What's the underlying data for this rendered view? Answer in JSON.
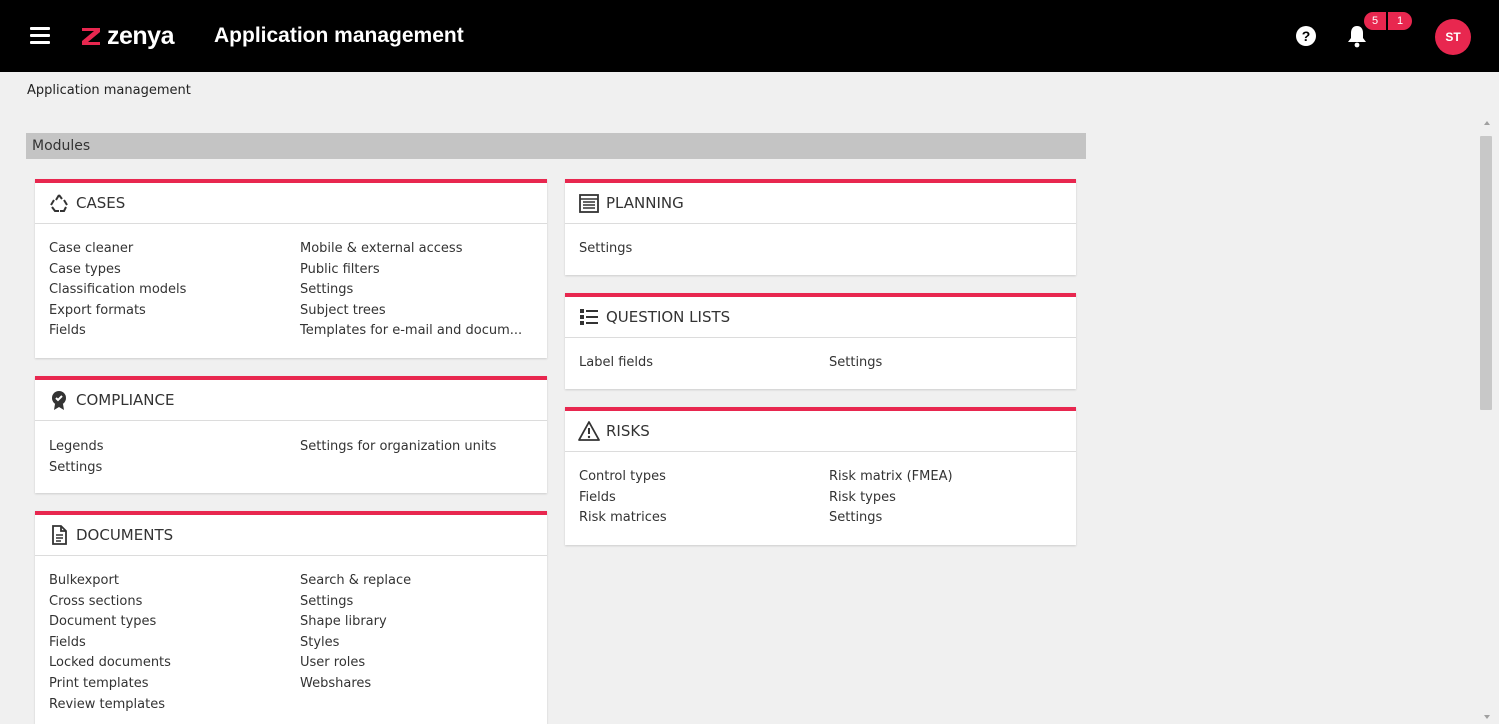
{
  "header": {
    "logo_text": "zenya",
    "title": "Application management",
    "help_symbol": "?",
    "badge_count_1": "5",
    "badge_count_2": "1",
    "avatar_initials": "ST",
    "brand_color": "#e8274f"
  },
  "breadcrumb": "Application management",
  "modules_label": "Modules",
  "cards": {
    "cases": {
      "icon": "recycle-icon",
      "title": "CASES",
      "col1": [
        "Case cleaner",
        "Case types",
        "Classification models",
        "Export formats",
        "Fields"
      ],
      "col2": [
        "Mobile & external access",
        "Public filters",
        "Settings",
        "Subject trees",
        "Templates for e-mail and docum..."
      ]
    },
    "compliance": {
      "icon": "badge-icon",
      "title": "COMPLIANCE",
      "col1": [
        "Legends",
        "Settings"
      ],
      "col2": [
        "Settings for organization units"
      ]
    },
    "documents": {
      "icon": "document-icon",
      "title": "DOCUMENTS",
      "col1": [
        "Bulkexport",
        "Cross sections",
        "Document types",
        "Fields",
        "Locked documents",
        "Print templates",
        "Review templates"
      ],
      "col2": [
        "Search & replace",
        "Settings",
        "Shape library",
        "Styles",
        "User roles",
        "Webshares"
      ]
    },
    "planning": {
      "icon": "planning-icon",
      "title": "PLANNING",
      "col1": [
        "Settings"
      ],
      "col2": []
    },
    "question_lists": {
      "icon": "checklist-icon",
      "title": "QUESTION LISTS",
      "col1": [
        "Label fields"
      ],
      "col2": [
        "Settings"
      ]
    },
    "risks": {
      "icon": "warning-icon",
      "title": "RISKS",
      "col1": [
        "Control types",
        "Fields",
        "Risk matrices"
      ],
      "col2": [
        "Risk matrix (FMEA)",
        "Risk types",
        "Settings"
      ]
    }
  }
}
